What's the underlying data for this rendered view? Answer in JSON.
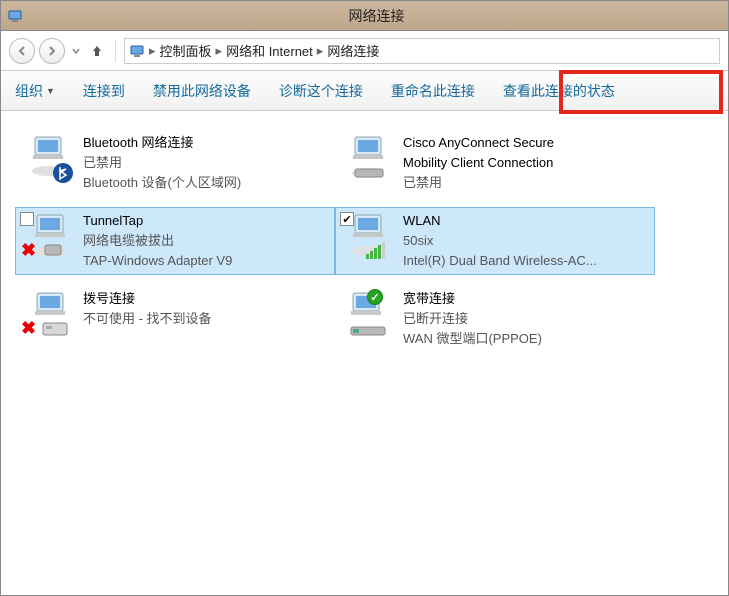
{
  "window": {
    "title": "网络连接"
  },
  "breadcrumb": {
    "items": [
      "控制面板",
      "网络和 Internet",
      "网络连接"
    ]
  },
  "toolbar": {
    "organize": "组织",
    "connect_to": "连接到",
    "disable_device": "禁用此网络设备",
    "diagnose": "诊断这个连接",
    "rename": "重命名此连接",
    "view_status": "查看此连接的状态"
  },
  "connections": {
    "bluetooth": {
      "name": "Bluetooth 网络连接",
      "status": "已禁用",
      "device": "Bluetooth 设备(个人区域网)"
    },
    "cisco": {
      "name": "Cisco AnyConnect Secure",
      "name2": "Mobility Client Connection",
      "status": "已禁用"
    },
    "tunneltap": {
      "name": "TunnelTap",
      "status": "网络电缆被拔出",
      "device": "TAP-Windows Adapter V9"
    },
    "wlan": {
      "name": "WLAN",
      "status": "50six",
      "device": "Intel(R) Dual Band Wireless-AC..."
    },
    "dialup": {
      "name": "拨号连接",
      "status": "不可使用 - 找不到设备"
    },
    "broadband": {
      "name": "宽带连接",
      "status": "已断开连接",
      "device": "WAN 微型端口(PPPOE)"
    }
  }
}
